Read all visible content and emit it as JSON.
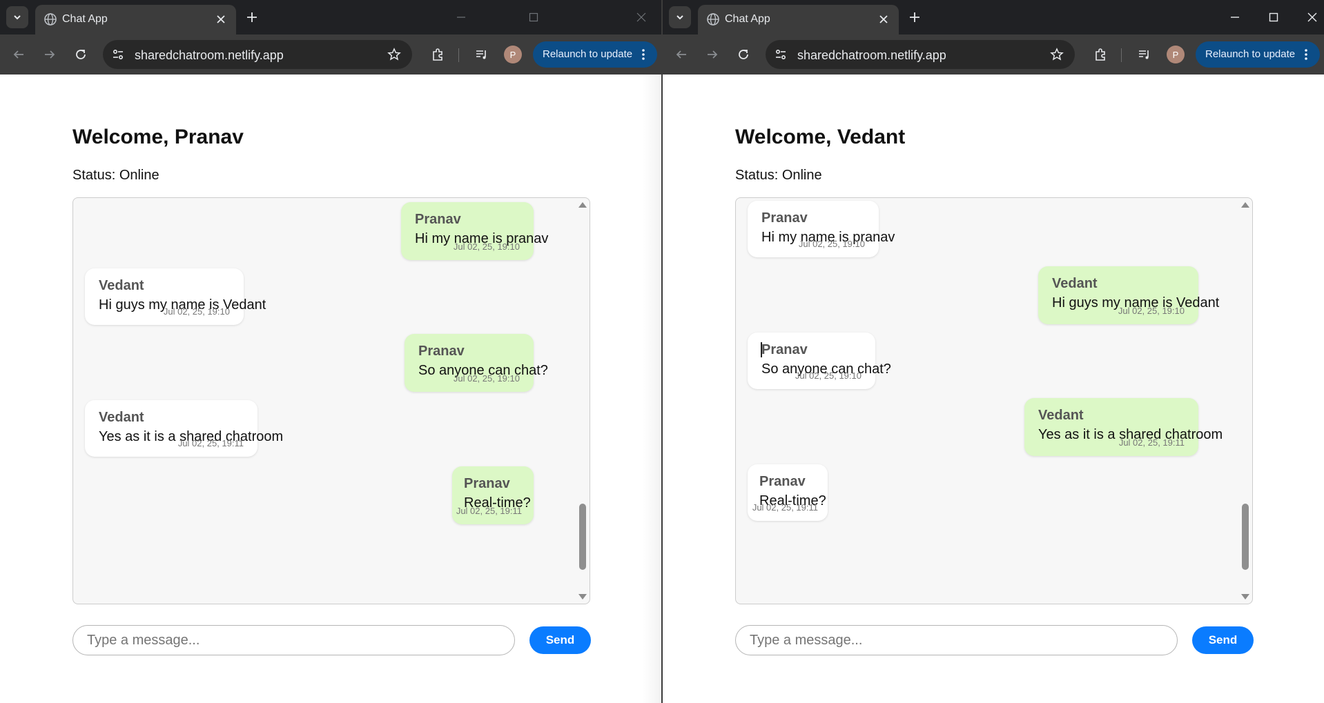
{
  "colors": {
    "tabstrip": "#202124",
    "toolbar": "#3c3c3c",
    "relaunch": "#0c4d87",
    "own_bubble": "#dcf8c6",
    "other_bubble": "#ffffff",
    "send_button": "#0a7cff"
  },
  "windows": [
    {
      "tab": {
        "title": "Chat App",
        "favicon": "globe-icon"
      },
      "toolbar": {
        "url": "sharedchatroom.netlify.app",
        "profile_initial": "P",
        "relaunch_label": "Relaunch to update"
      },
      "page": {
        "welcome": "Welcome, Pranav",
        "status": "Status: Online",
        "messages": [
          {
            "sender": "Pranav",
            "text": "Hi my name is pranav",
            "time": "Jul 02, 25, 19:10",
            "own": true
          },
          {
            "sender": "Vedant",
            "text": "Hi guys my name is Vedant",
            "time": "Jul 02, 25, 19:10",
            "own": false
          },
          {
            "sender": "Pranav",
            "text": "So anyone can chat?",
            "time": "Jul 02, 25, 19:10",
            "own": true
          },
          {
            "sender": "Vedant",
            "text": "Yes as it is a shared chatroom",
            "time": "Jul 02, 25, 19:11",
            "own": false
          },
          {
            "sender": "Pranav",
            "text": "Real-time?",
            "time": "Jul 02, 25, 19:11",
            "own": true
          }
        ],
        "input_placeholder": "Type a message...",
        "send_label": "Send"
      }
    },
    {
      "tab": {
        "title": "Chat App",
        "favicon": "globe-icon"
      },
      "toolbar": {
        "url": "sharedchatroom.netlify.app",
        "profile_initial": "P",
        "relaunch_label": "Relaunch to update"
      },
      "page": {
        "welcome": "Welcome, Vedant",
        "status": "Status: Online",
        "messages": [
          {
            "sender": "Pranav",
            "text": "Hi my name is pranav",
            "time": "Jul 02, 25, 19:10",
            "own": false
          },
          {
            "sender": "Vedant",
            "text": "Hi guys my name is Vedant",
            "time": "Jul 02, 25, 19:10",
            "own": true
          },
          {
            "sender": "Pranav",
            "text": "So anyone can chat?",
            "time": "Jul 02, 25, 19:10",
            "own": false
          },
          {
            "sender": "Vedant",
            "text": "Yes as it is a shared chatroom",
            "time": "Jul 02, 25, 19:11",
            "own": true
          },
          {
            "sender": "Pranav",
            "text": "Real-time?",
            "time": "Jul 02, 25, 19:11",
            "own": false
          }
        ],
        "input_placeholder": "Type a message...",
        "send_label": "Send"
      }
    }
  ]
}
